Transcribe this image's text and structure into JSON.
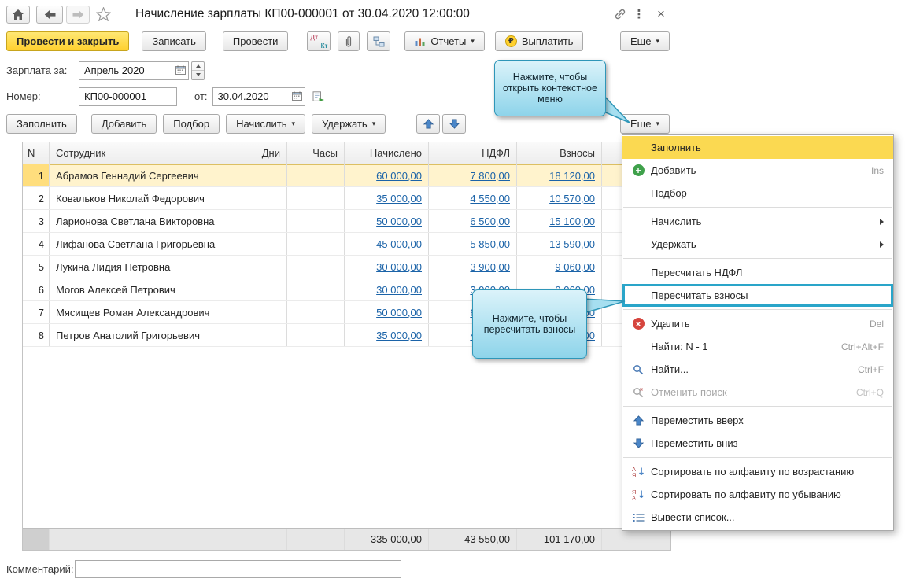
{
  "window": {
    "title": "Начисление зарплаты КП00-000001 от 30.04.2020 12:00:00"
  },
  "toolbar": {
    "post_and_close": "Провести и закрыть",
    "write": "Записать",
    "post": "Провести",
    "reports": "Отчеты",
    "pay": "Выплатить",
    "more": "Еще"
  },
  "form": {
    "salary_label": "Зарплата за:",
    "salary_value": "Апрель 2020",
    "number_label": "Номер:",
    "number_value": "КП00-000001",
    "date_label": "от:",
    "date_value": "30.04.2020"
  },
  "table_toolbar": {
    "fill": "Заполнить",
    "add": "Добавить",
    "pick": "Подбор",
    "accrue": "Начислить",
    "withhold": "Удержать",
    "more": "Еще"
  },
  "callouts": {
    "context_menu": "Нажмите, чтобы открыть контекстное меню",
    "recalculate": "Нажмите, чтобы пересчитать взносы"
  },
  "table": {
    "columns": [
      "N",
      "Сотрудник",
      "Дни",
      "Часы",
      "Начислено",
      "НДФЛ",
      "Взносы"
    ],
    "rows": [
      {
        "n": "1",
        "name": "Абрамов Геннадий Сергеевич",
        "days": "",
        "hours": "",
        "accrued": "60 000,00",
        "ndfl": "7 800,00",
        "contributions": "18 120,00"
      },
      {
        "n": "2",
        "name": "Ковальков Николай Федорович",
        "days": "",
        "hours": "",
        "accrued": "35 000,00",
        "ndfl": "4 550,00",
        "contributions": "10 570,00"
      },
      {
        "n": "3",
        "name": "Ларионова Светлана Викторовна",
        "days": "",
        "hours": "",
        "accrued": "50 000,00",
        "ndfl": "6 500,00",
        "contributions": "15 100,00"
      },
      {
        "n": "4",
        "name": "Лифанова Светлана Григорьевна",
        "days": "",
        "hours": "",
        "accrued": "45 000,00",
        "ndfl": "5 850,00",
        "contributions": "13 590,00"
      },
      {
        "n": "5",
        "name": "Лукина Лидия Петровна",
        "days": "",
        "hours": "",
        "accrued": "30 000,00",
        "ndfl": "3 900,00",
        "contributions": "9 060,00"
      },
      {
        "n": "6",
        "name": "Могов Алексей Петрович",
        "days": "",
        "hours": "",
        "accrued": "30 000,00",
        "ndfl": "3 900,00",
        "contributions": "9 060,00"
      },
      {
        "n": "7",
        "name": "Мясищев Роман Александрович",
        "days": "",
        "hours": "",
        "accrued": "50 000,00",
        "ndfl": "6 500,00",
        "contributions": "15 100,00"
      },
      {
        "n": "8",
        "name": "Петров Анатолий Григорьевич",
        "days": "",
        "hours": "",
        "accrued": "35 000,00",
        "ndfl": "4 550,00",
        "contributions": "10 570,00"
      }
    ],
    "totals": {
      "accrued": "335 000,00",
      "ndfl": "43 550,00",
      "contributions": "101 170,00"
    }
  },
  "comment": {
    "label": "Комментарий:",
    "value": ""
  },
  "menu": {
    "items": [
      {
        "id": "fill",
        "label": "Заполнить",
        "highlight": "yellow"
      },
      {
        "id": "add",
        "label": "Добавить",
        "icon": "add",
        "shortcut": "Ins"
      },
      {
        "id": "pick",
        "label": "Подбор"
      },
      {
        "sep": true
      },
      {
        "id": "accrue",
        "label": "Начислить",
        "submenu": true
      },
      {
        "id": "withhold",
        "label": "Удержать",
        "submenu": true
      },
      {
        "sep": true
      },
      {
        "id": "recalc-ndfl",
        "label": "Пересчитать НДФЛ"
      },
      {
        "id": "recalc-contributions",
        "label": "Пересчитать взносы",
        "highlight": "cyan"
      },
      {
        "sep": true
      },
      {
        "id": "delete",
        "label": "Удалить",
        "icon": "delete",
        "shortcut": "Del"
      },
      {
        "id": "find-current",
        "label": "Найти: N - 1",
        "shortcut": "Ctrl+Alt+F"
      },
      {
        "id": "find",
        "label": "Найти...",
        "icon": "search",
        "shortcut": "Ctrl+F"
      },
      {
        "id": "cancel-search",
        "label": "Отменить поиск",
        "icon": "search-cancel",
        "shortcut": "Ctrl+Q",
        "disabled": true
      },
      {
        "sep": true
      },
      {
        "id": "move-up",
        "label": "Переместить вверх",
        "icon": "up"
      },
      {
        "id": "move-down",
        "label": "Переместить вниз",
        "icon": "down"
      },
      {
        "sep": true
      },
      {
        "id": "sort-asc",
        "label": "Сортировать по алфавиту по возрастанию",
        "icon": "sort-asc"
      },
      {
        "id": "sort-desc",
        "label": "Сортировать по алфавиту по убыванию",
        "icon": "sort-desc"
      },
      {
        "id": "output-list",
        "label": "Вывести список...",
        "icon": "list"
      }
    ]
  },
  "colors": {
    "primary_button": "#ffd02e",
    "selected_row": "#fff3cd",
    "menu_highlight": "#fbd951",
    "callout_border": "#2e96b8",
    "callout_fill": "#9edcef",
    "link": "#1b63a8"
  },
  "icons": {
    "home": "house",
    "back": "arrow-left",
    "forward": "arrow-right",
    "favorite": "star",
    "link": "chain",
    "window_menu": "kebab",
    "close": "x",
    "dtkt": "ДтКт",
    "attachments": "paperclip",
    "related": "linked-docs",
    "reports": "bar-chart",
    "pay": "ruble-circle",
    "calendar": "calendar",
    "move_up": "arrow-up-blue",
    "move_down": "arrow-down-blue"
  }
}
